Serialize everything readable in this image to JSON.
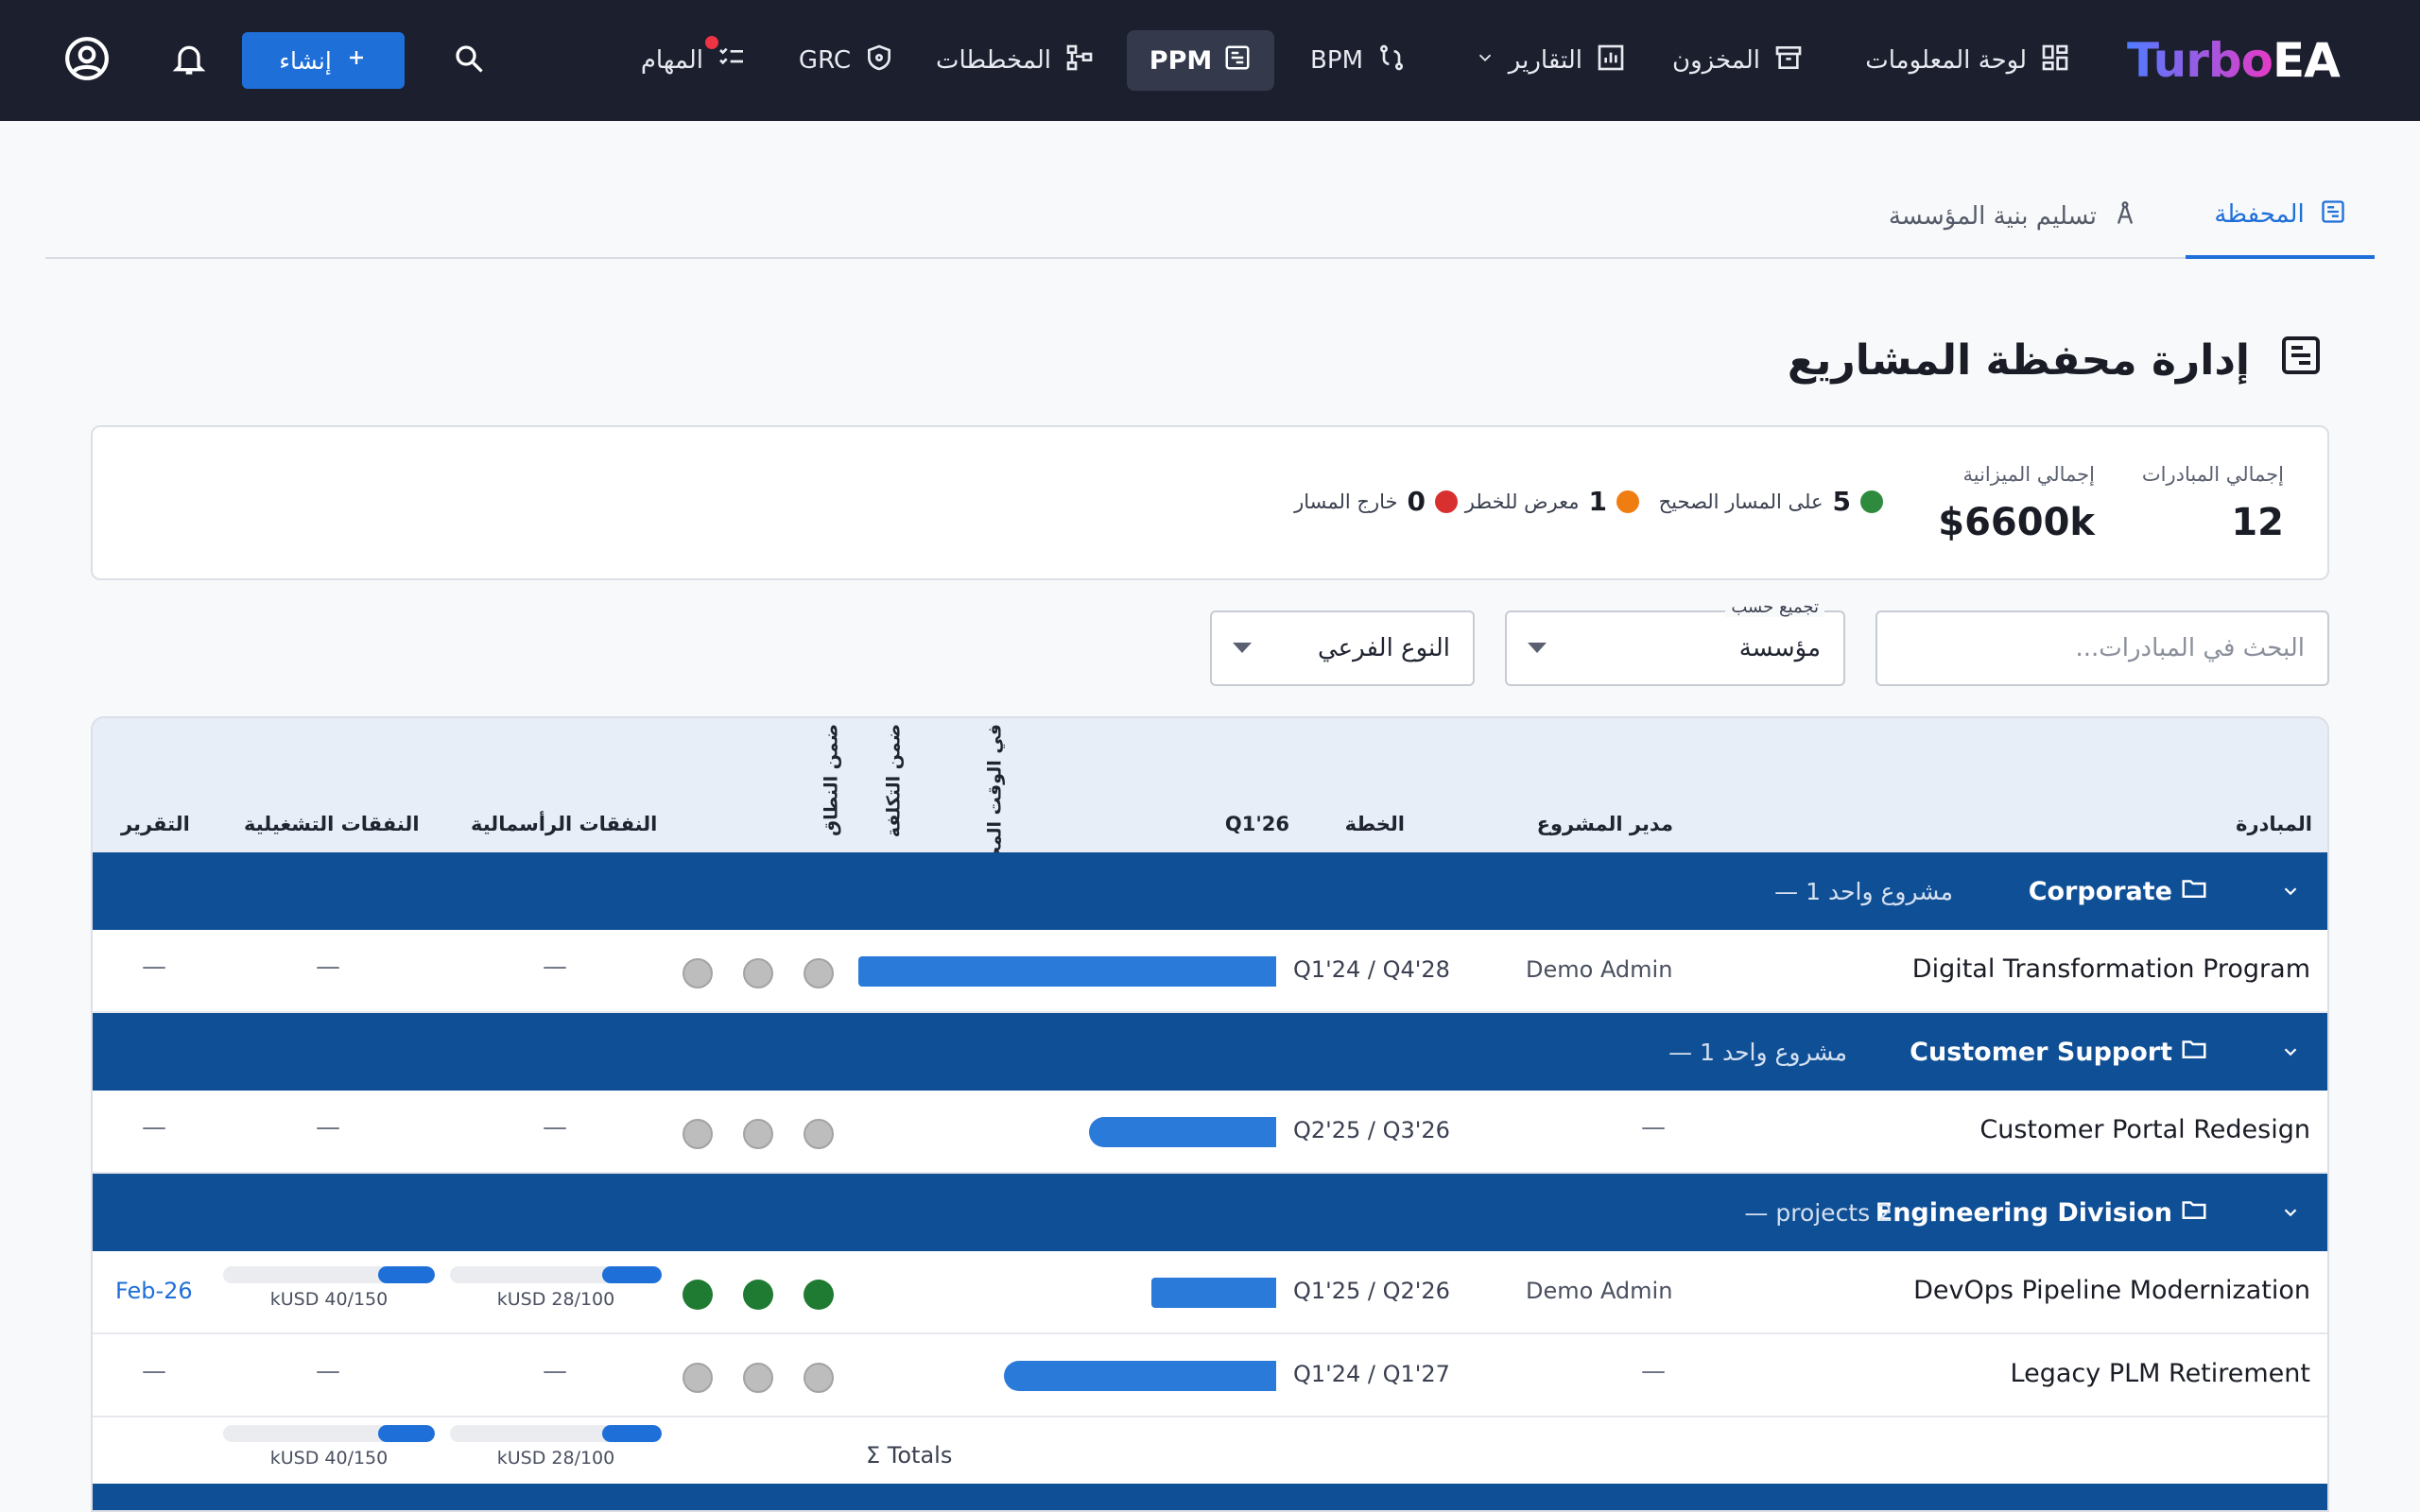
{
  "brand": {
    "logo_part1": "Turbo",
    "logo_part2": "EA"
  },
  "nav": {
    "items": [
      {
        "label": "لوحة المعلومات",
        "icon": "dashboard-icon"
      },
      {
        "label": "المخزون",
        "icon": "archive-icon"
      },
      {
        "label": "التقارير",
        "icon": "report-chart-icon"
      },
      {
        "label": "BPM",
        "icon": "process-icon"
      },
      {
        "label": "PPM",
        "icon": "ppm-icon"
      },
      {
        "label": "المخططات",
        "icon": "diagram-icon"
      },
      {
        "label": "GRC",
        "icon": "shield-icon"
      },
      {
        "label": "المهام",
        "icon": "tasks-icon"
      }
    ],
    "create_label": "إنشاء"
  },
  "tabs": [
    {
      "label": "المحفظة",
      "active": true
    },
    {
      "label": "تسليم بنية المؤسسة",
      "active": false
    }
  ],
  "page": {
    "title": "إدارة محفظة المشاريع"
  },
  "summary": {
    "total_initiatives_label": "إجمالي المبادرات",
    "total_initiatives_value": "12",
    "total_budget_label": "إجمالي الميزانية",
    "total_budget_value": "$6600k",
    "on_track_count": "5",
    "on_track_label": "على المسار الصحيح",
    "at_risk_count": "1",
    "at_risk_label": "معرض للخطر",
    "off_track_count": "0",
    "off_track_label": "خارج المسار"
  },
  "filters": {
    "search_placeholder": "البحث في المبادرات...",
    "group_by_label": "تجميع حسب",
    "group_by_value": "مؤسسة",
    "subtype_value": "النوع الفرعي"
  },
  "columns": {
    "initiative": "المبادرة",
    "manager": "مدير المشروع",
    "plan": "الخطة",
    "quarter": "Q1'26",
    "on_time": "في الوقت المحدد",
    "on_cost": "ضمن التكلفة",
    "on_scope": "ضمن النطاق",
    "capex": "النفقات الرأسمالية",
    "opex": "النفقات التشغيلية",
    "report": "التقرير"
  },
  "groups": [
    {
      "name": "Corporate",
      "count": "مشروع واحد 1 —"
    },
    {
      "name": "Customer Support",
      "count": "مشروع واحد 1 —"
    },
    {
      "name": "Engineering Division",
      "count": "projects 2 —"
    }
  ],
  "rows": [
    {
      "name": "Digital Transformation Program",
      "manager": "Demo Admin",
      "plan": "Q1'24 / Q4'28",
      "report": "—",
      "opex": "—",
      "capex": "—"
    },
    {
      "name": "Customer Portal Redesign",
      "manager": "—",
      "plan": "Q2'25 / Q3'26",
      "report": "—",
      "opex": "—",
      "capex": "—"
    },
    {
      "name": "DevOps Pipeline Modernization",
      "manager": "Demo Admin",
      "plan": "Q1'25 / Q2'26",
      "report": "Feb-26",
      "opex": "kUSD 40/150",
      "capex": "kUSD 28/100",
      "opex_fraction": 0.27,
      "capex_fraction": 0.28
    },
    {
      "name": "Legacy PLM Retirement",
      "manager": "—",
      "plan": "Q1'24 / Q1'27",
      "report": "—",
      "opex": "—",
      "capex": "—"
    }
  ],
  "totals": {
    "label": "Σ Totals",
    "opex": "kUSD 40/150",
    "capex": "kUSD 28/100"
  },
  "colors": {
    "topbar": "#1b1f2e",
    "accent": "#1f6fd9",
    "group_band": "#0f4f96",
    "on_track": "#2e8b3e",
    "at_risk": "#f07d12",
    "off_track": "#d8302f",
    "neutral_status": "#bdbdbd"
  }
}
